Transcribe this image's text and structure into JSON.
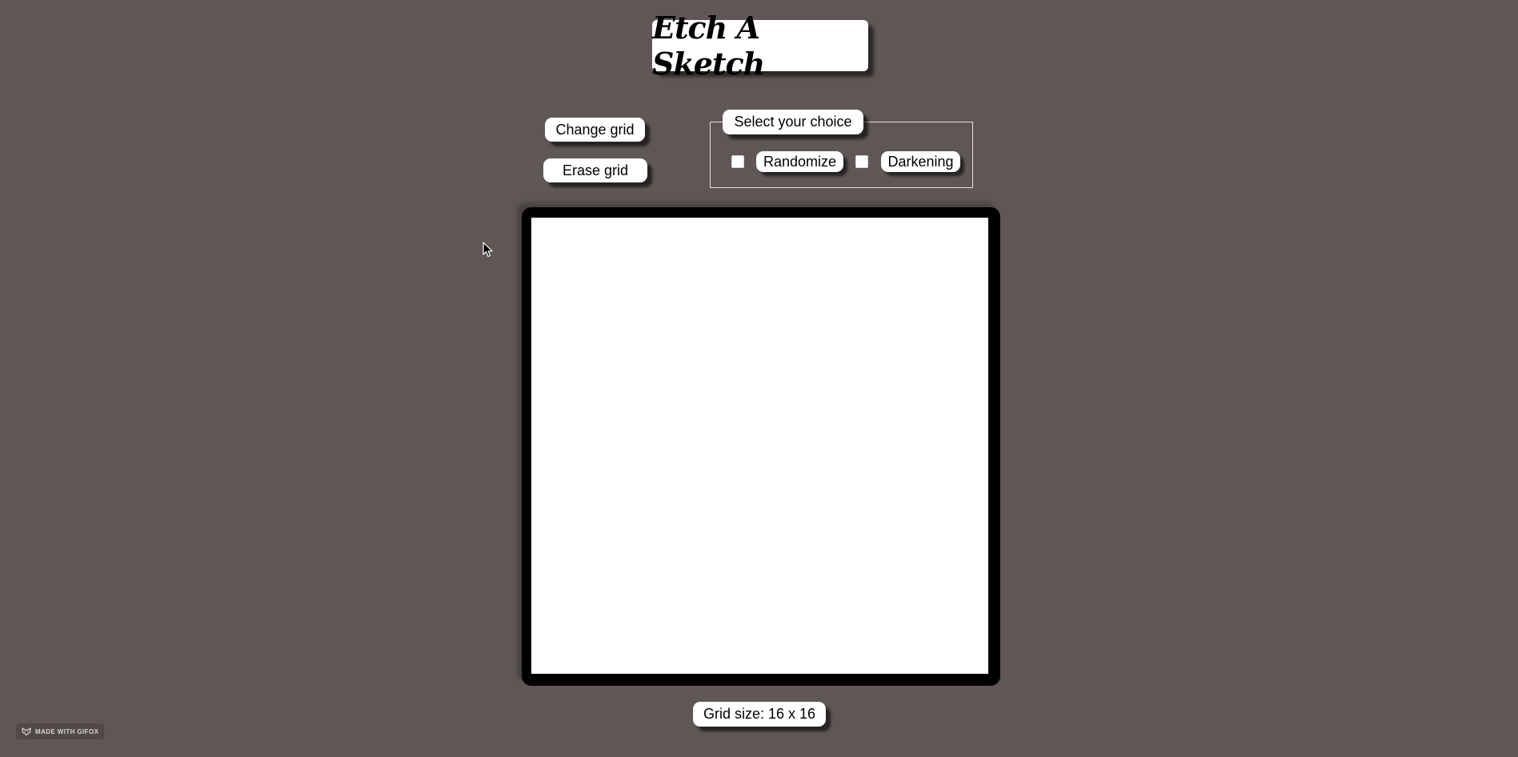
{
  "header": {
    "title": "Etch A Sketch"
  },
  "controls": {
    "change_grid_label": "Change grid",
    "erase_grid_label": "Erase grid"
  },
  "choice": {
    "legend": "Select your choice",
    "randomize_label": "Randomize",
    "randomize_checked": false,
    "darkening_label": "Darkening",
    "darkening_checked": false
  },
  "footer": {
    "grid_size_text": "Grid size: 16 x 16"
  },
  "badge": {
    "text": "MADE WITH GIFOX",
    "icon": "fox-icon"
  },
  "colors": {
    "background": "#5f5756",
    "board_frame": "#000000",
    "board_surface": "#ffffff"
  }
}
